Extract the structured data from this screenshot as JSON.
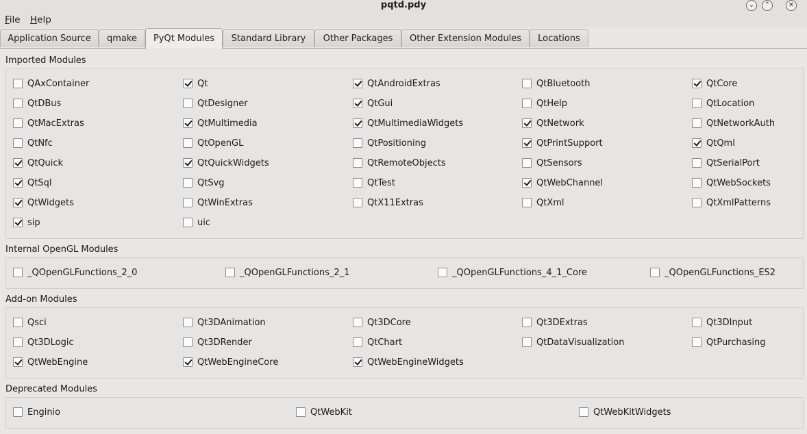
{
  "window": {
    "title": "pqtd.pdy"
  },
  "menu": [
    {
      "label": "File",
      "mnemonic": "F",
      "rest": "ile"
    },
    {
      "label": "Help",
      "mnemonic": "H",
      "rest": "elp"
    }
  ],
  "window_buttons": {
    "minimize": "⌄",
    "maximize": "⌃",
    "close": "✕"
  },
  "tabs": [
    {
      "label": "Application Source",
      "active": false
    },
    {
      "label": "qmake",
      "active": false
    },
    {
      "label": "PyQt Modules",
      "active": true
    },
    {
      "label": "Standard Library",
      "active": false
    },
    {
      "label": "Other Packages",
      "active": false
    },
    {
      "label": "Other Extension Modules",
      "active": false
    },
    {
      "label": "Locations",
      "active": false
    }
  ],
  "groups": [
    {
      "title": "Imported Modules",
      "items": [
        {
          "label": "QAxContainer",
          "checked": false
        },
        {
          "label": "Qt",
          "checked": true
        },
        {
          "label": "QtAndroidExtras",
          "checked": true
        },
        {
          "label": "QtBluetooth",
          "checked": false
        },
        {
          "label": "QtCore",
          "checked": true
        },
        {
          "label": "QtDBus",
          "checked": false
        },
        {
          "label": "QtDesigner",
          "checked": false
        },
        {
          "label": "QtGui",
          "checked": true
        },
        {
          "label": "QtHelp",
          "checked": false
        },
        {
          "label": "QtLocation",
          "checked": false
        },
        {
          "label": "QtMacExtras",
          "checked": false
        },
        {
          "label": "QtMultimedia",
          "checked": true
        },
        {
          "label": "QtMultimediaWidgets",
          "checked": true
        },
        {
          "label": "QtNetwork",
          "checked": true
        },
        {
          "label": "QtNetworkAuth",
          "checked": false
        },
        {
          "label": "QtNfc",
          "checked": false
        },
        {
          "label": "QtOpenGL",
          "checked": false
        },
        {
          "label": "QtPositioning",
          "checked": false
        },
        {
          "label": "QtPrintSupport",
          "checked": true
        },
        {
          "label": "QtQml",
          "checked": true
        },
        {
          "label": "QtQuick",
          "checked": true
        },
        {
          "label": "QtQuickWidgets",
          "checked": true
        },
        {
          "label": "QtRemoteObjects",
          "checked": false
        },
        {
          "label": "QtSensors",
          "checked": false
        },
        {
          "label": "QtSerialPort",
          "checked": false
        },
        {
          "label": "QtSql",
          "checked": true
        },
        {
          "label": "QtSvg",
          "checked": false
        },
        {
          "label": "QtTest",
          "checked": false
        },
        {
          "label": "QtWebChannel",
          "checked": true
        },
        {
          "label": "QtWebSockets",
          "checked": false
        },
        {
          "label": "QtWidgets",
          "checked": true
        },
        {
          "label": "QtWinExtras",
          "checked": false
        },
        {
          "label": "QtX11Extras",
          "checked": false
        },
        {
          "label": "QtXml",
          "checked": false
        },
        {
          "label": "QtXmlPatterns",
          "checked": false
        },
        {
          "label": "sip",
          "checked": true
        },
        {
          "label": "uic",
          "checked": false
        }
      ]
    },
    {
      "title": "Internal OpenGL Modules",
      "items": [
        {
          "label": "_QOpenGLFunctions_2_0",
          "checked": false
        },
        {
          "label": "_QOpenGLFunctions_2_1",
          "checked": false
        },
        {
          "label": "_QOpenGLFunctions_4_1_Core",
          "checked": false
        },
        {
          "label": "_QOpenGLFunctions_ES2",
          "checked": false
        }
      ]
    },
    {
      "title": "Add-on Modules",
      "items": [
        {
          "label": "Qsci",
          "checked": false
        },
        {
          "label": "Qt3DAnimation",
          "checked": false
        },
        {
          "label": "Qt3DCore",
          "checked": false
        },
        {
          "label": "Qt3DExtras",
          "checked": false
        },
        {
          "label": "Qt3DInput",
          "checked": false
        },
        {
          "label": "Qt3DLogic",
          "checked": false
        },
        {
          "label": "Qt3DRender",
          "checked": false
        },
        {
          "label": "QtChart",
          "checked": false
        },
        {
          "label": "QtDataVisualization",
          "checked": false
        },
        {
          "label": "QtPurchasing",
          "checked": false
        },
        {
          "label": "QtWebEngine",
          "checked": true
        },
        {
          "label": "QtWebEngineCore",
          "checked": true
        },
        {
          "label": "QtWebEngineWidgets",
          "checked": true
        }
      ]
    },
    {
      "title": "Deprecated Modules",
      "items": [
        {
          "label": "Enginio",
          "checked": false
        },
        {
          "label": "QtWebKit",
          "checked": false
        },
        {
          "label": "QtWebKitWidgets",
          "checked": false
        }
      ]
    }
  ]
}
